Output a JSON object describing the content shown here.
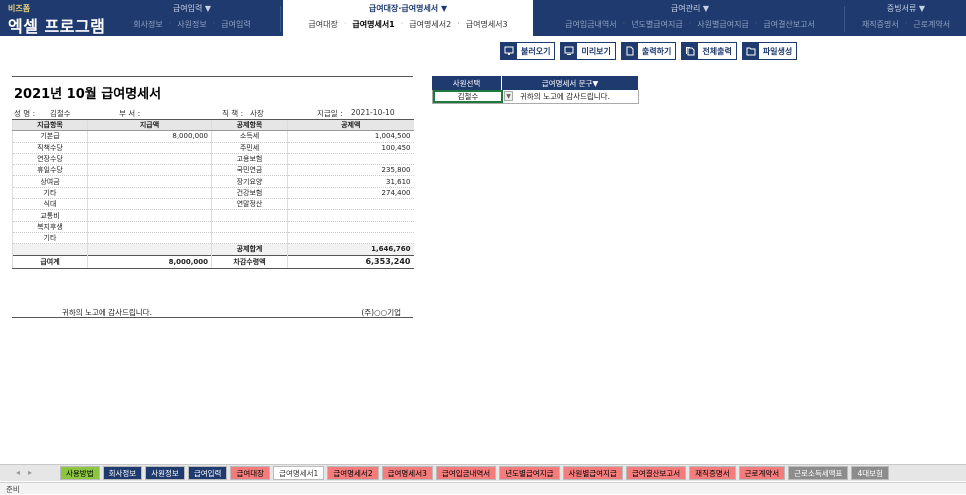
{
  "brand": {
    "sub": "비즈폼",
    "main": "엑셀 프로그램"
  },
  "menus": [
    {
      "title": "급여입력 ▼",
      "items": [
        "회사정보",
        "사원정보",
        "급여입력"
      ]
    },
    {
      "title": "급여대장·급여명세서 ▼",
      "items": [
        "급여대장",
        "급여명세서1",
        "급여명세서2",
        "급여명세서3"
      ]
    },
    {
      "title": "급여관리 ▼",
      "items": [
        "급여입금내역서",
        "년도별급여지급",
        "사원별급여지급",
        "급여결산보고서"
      ]
    },
    {
      "title": "증빙서류 ▼",
      "items": [
        "재직증명서",
        "근로계약서"
      ]
    }
  ],
  "toolbar": {
    "load": "불러오기",
    "preview": "미리보기",
    "print": "출력하기",
    "print_all": "전체출력",
    "make_file": "파일생성"
  },
  "sheet": {
    "title": "2021년 10월 급여명세서",
    "name_label": "성 명 :",
    "name_value": "김철수",
    "dept_label": "부 서 :",
    "dept_value": "",
    "position_label": "직 책 :",
    "position_value": "사장",
    "paydate_label": "지급일 :",
    "paydate_value": "2021-10-10",
    "headers": {
      "pay_item": "지급항목",
      "pay_amount": "지급액",
      "ded_item": "공제항목",
      "ded_amount": "공제액"
    },
    "rows": [
      {
        "pay_item": "기본급",
        "pay_amount": "8,000,000",
        "ded_item": "소득세",
        "ded_amount": "1,004,500"
      },
      {
        "pay_item": "직책수당",
        "pay_amount": "",
        "ded_item": "주민세",
        "ded_amount": "100,450"
      },
      {
        "pay_item": "연장수당",
        "pay_amount": "",
        "ded_item": "고용보험",
        "ded_amount": ""
      },
      {
        "pay_item": "휴일수당",
        "pay_amount": "",
        "ded_item": "국민연금",
        "ded_amount": "235,800"
      },
      {
        "pay_item": "상여금",
        "pay_amount": "",
        "ded_item": "장기요양",
        "ded_amount": "31,610"
      },
      {
        "pay_item": "기타",
        "pay_amount": "",
        "ded_item": "건강보험",
        "ded_amount": "274,400"
      },
      {
        "pay_item": "식대",
        "pay_amount": "",
        "ded_item": "연말정산",
        "ded_amount": ""
      },
      {
        "pay_item": "교통비",
        "pay_amount": "",
        "ded_item": "",
        "ded_amount": ""
      },
      {
        "pay_item": "복지후생",
        "pay_amount": "",
        "ded_item": "",
        "ded_amount": ""
      },
      {
        "pay_item": "기타",
        "pay_amount": "",
        "ded_item": "",
        "ded_amount": ""
      }
    ],
    "deduction_total_label": "공제합계",
    "deduction_total_value": "1,646,760",
    "pay_total_label": "급여계",
    "pay_total_value": "8,000,000",
    "net_label": "차감수령액",
    "net_value": "6,353,240",
    "footer_message": "귀하의 노고에 감사드립니다.",
    "footer_company": "(주)○○기업"
  },
  "selector": {
    "col1_header": "사원선택",
    "col2_header": "급여명세서 문구▼",
    "employee": "김철수",
    "message": "귀하의 노고에 감사드립니다."
  },
  "sheet_tabs": [
    {
      "label": "사용방법",
      "bg": "#8cc63f",
      "fg": "#000"
    },
    {
      "label": "회사정보",
      "bg": "#1f3a6e",
      "fg": "#fff"
    },
    {
      "label": "사원정보",
      "bg": "#1f3a6e",
      "fg": "#fff"
    },
    {
      "label": "급여입력",
      "bg": "#1f3a6e",
      "fg": "#fff"
    },
    {
      "label": "급여대장",
      "bg": "#f47c7c",
      "fg": "#000"
    },
    {
      "label": "급여명세서1",
      "bg": "#ffffff",
      "fg": "#333"
    },
    {
      "label": "급여명세서2",
      "bg": "#f47c7c",
      "fg": "#000"
    },
    {
      "label": "급여명세서3",
      "bg": "#f47c7c",
      "fg": "#000"
    },
    {
      "label": "급여입금내역서",
      "bg": "#f47c7c",
      "fg": "#000"
    },
    {
      "label": "년도별급여지급",
      "bg": "#f47c7c",
      "fg": "#000"
    },
    {
      "label": "사원별급여지급",
      "bg": "#f47c7c",
      "fg": "#000"
    },
    {
      "label": "급여결산보고서",
      "bg": "#f47c7c",
      "fg": "#000"
    },
    {
      "label": "재직증명서",
      "bg": "#f47c7c",
      "fg": "#000"
    },
    {
      "label": "근로계약서",
      "bg": "#f47c7c",
      "fg": "#000"
    },
    {
      "label": "근로소득세액표",
      "bg": "#8c8c8c",
      "fg": "#fff"
    },
    {
      "label": "4대보험",
      "bg": "#8c8c8c",
      "fg": "#fff"
    }
  ],
  "status": {
    "ready": "준비"
  },
  "colors": {
    "navy": "#1f3a6e",
    "brand_gold": "#e8d27a",
    "tab_red": "#f47c7c",
    "tab_green": "#8cc63f"
  }
}
